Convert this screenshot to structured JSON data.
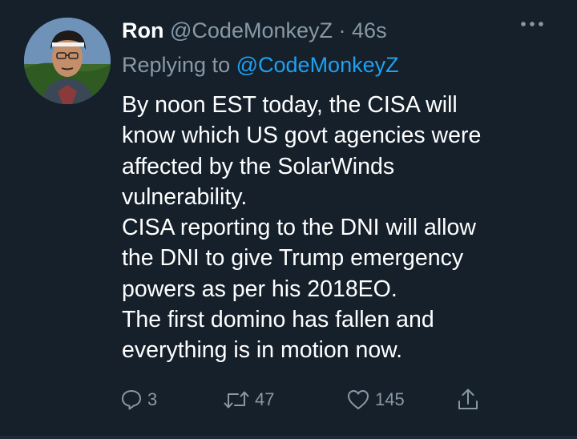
{
  "tweet": {
    "display_name": "Ron",
    "handle": "@CodeMonkeyZ",
    "separator": "·",
    "time": "46s",
    "replying_prefix": "Replying to",
    "replying_to": "@CodeMonkeyZ",
    "lines": [
      "By noon EST today, the CISA will",
      "know which US govt agencies were",
      "affected by the SolarWinds",
      "vulnerability.",
      "CISA reporting to the DNI will allow",
      "the DNI to give Trump emergency",
      "powers as per his 2018EO.",
      "The first domino has fallen and",
      "everything is in motion now."
    ]
  },
  "actions": {
    "replies": "3",
    "retweets": "47",
    "likes": "145"
  },
  "icons": {
    "reply": "reply-icon",
    "retweet": "retweet-icon",
    "like": "heart-icon",
    "share": "share-icon",
    "more": "more-icon"
  },
  "colors": {
    "background": "#15202b",
    "text": "#ffffff",
    "muted": "#8899a6",
    "link": "#1da1f2"
  }
}
